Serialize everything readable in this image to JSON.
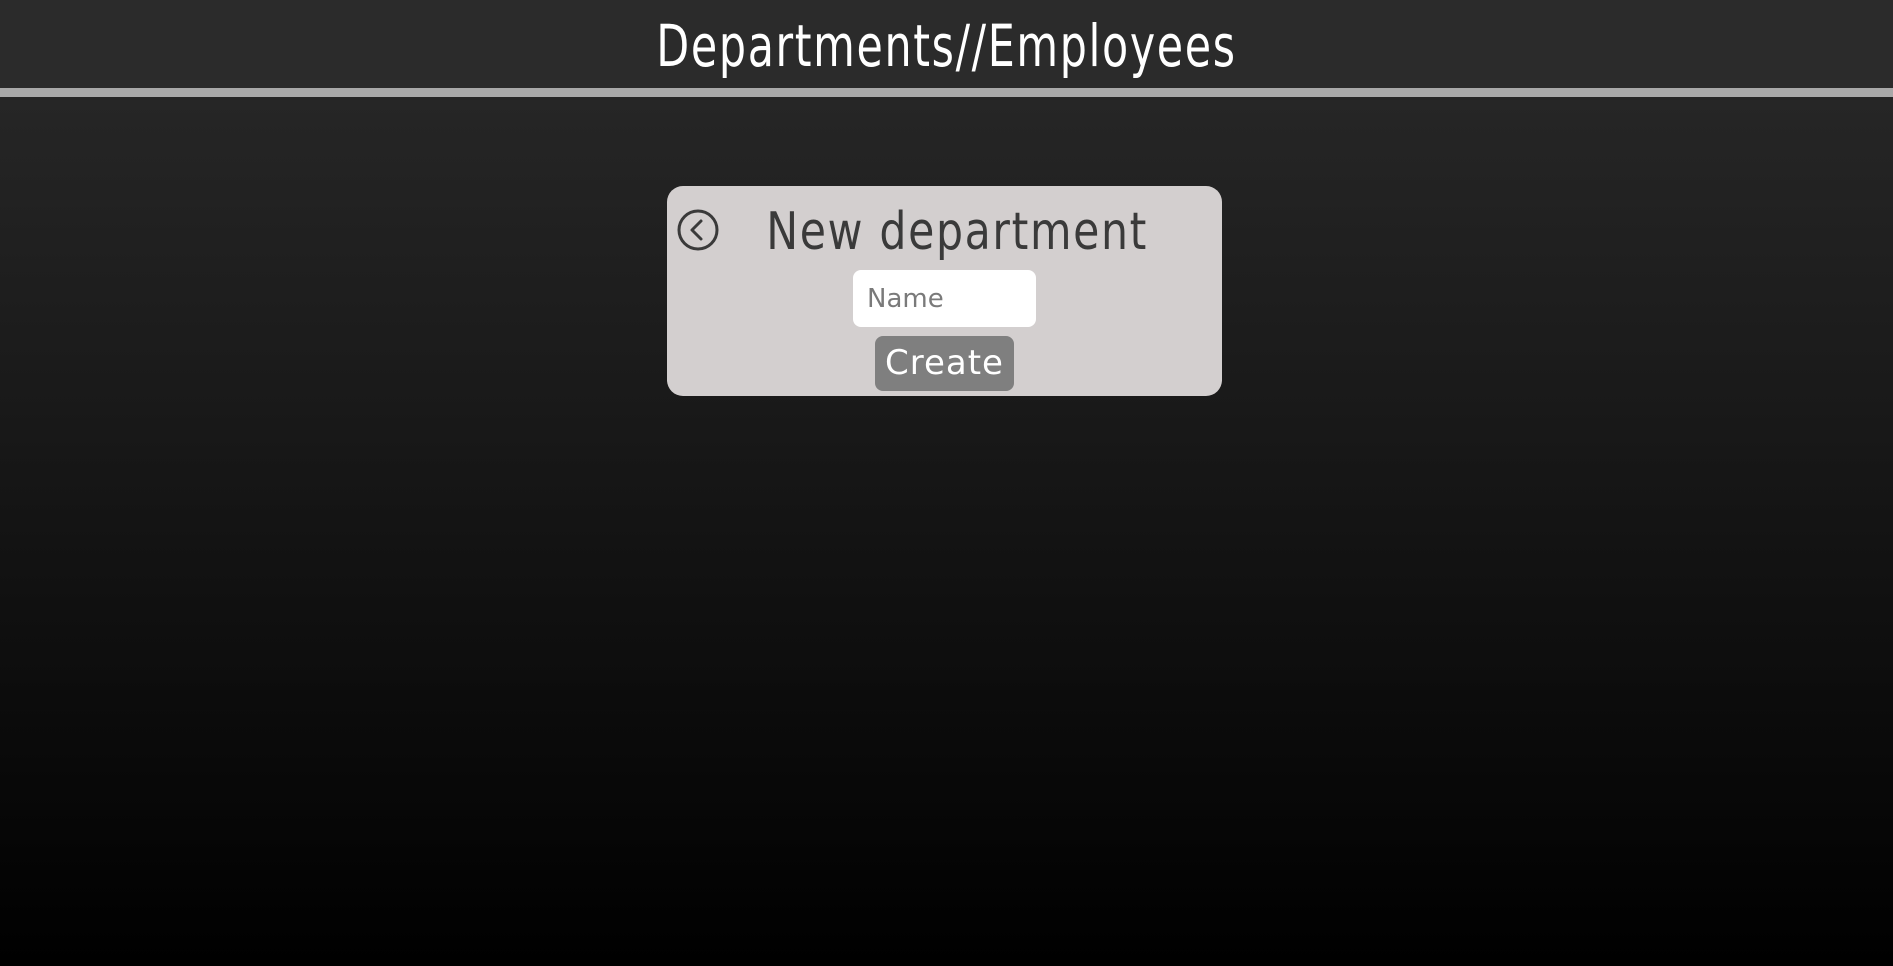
{
  "header": {
    "title": "Departments//Employees"
  },
  "form": {
    "title": "New department",
    "back_icon": "chevron-left-circle-icon",
    "name_placeholder": "Name",
    "name_value": "",
    "submit_label": "Create"
  },
  "colors": {
    "header_bg": "#2b2b2b",
    "header_border": "#a9a9a9",
    "card_bg": "#d3cfcf",
    "button_bg": "#7f7f7f",
    "title_text": "#3a3a3a"
  }
}
